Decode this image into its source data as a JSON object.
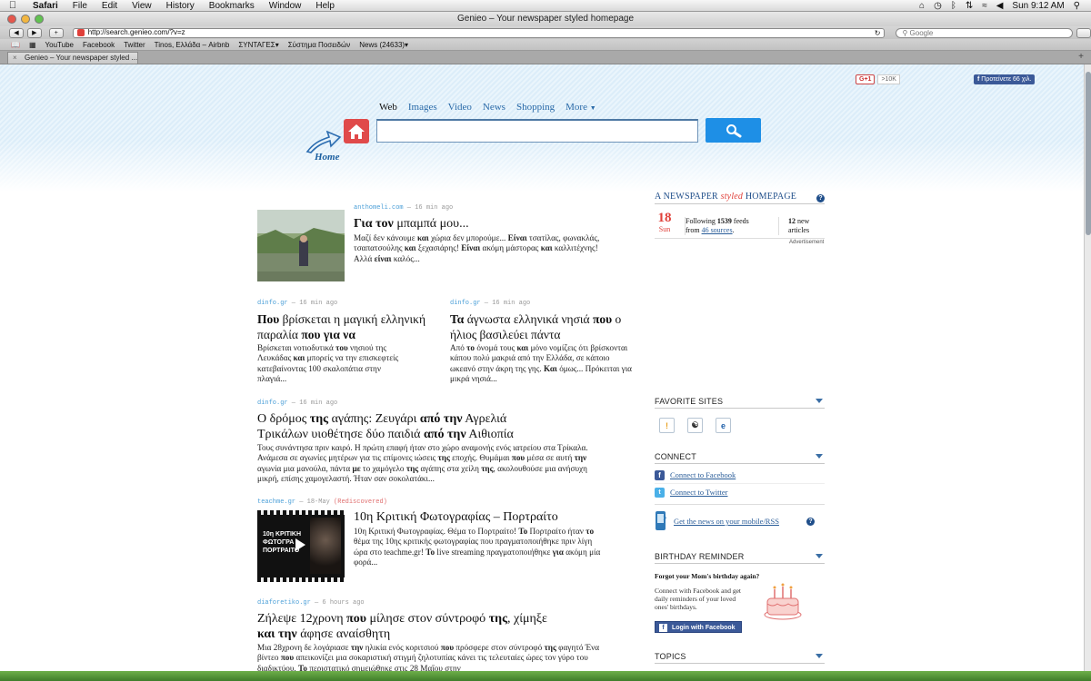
{
  "os_menu": {
    "app": "Safari",
    "items": [
      "File",
      "Edit",
      "View",
      "History",
      "Bookmarks",
      "Window",
      "Help"
    ],
    "clock": "Sun 9:12 AM"
  },
  "browser": {
    "window_title": "Genieo – Your newspaper styled homepage",
    "url": "http://search.genieo.com/?v=z",
    "search_placeholder": "Google",
    "bookmarks": [
      "YouTube",
      "Facebook",
      "Twitter",
      "Tinos, Ελλάδα – Airbnb",
      "ΣΥΝΤΑΓΕΣ▾",
      "Σύστημα Ποσειδών",
      "News (24633)▾"
    ],
    "tab_title": "Genieo – Your newspaper styled ..."
  },
  "page": {
    "social": {
      "gplus": "G+1",
      "gplus_count": ">10K",
      "fb_recommend": "Προτείνετε 66 χιλ."
    },
    "search_tabs": [
      "Web",
      "Images",
      "Video",
      "News",
      "Shopping",
      "More"
    ],
    "home_label": "Home",
    "search_value": ""
  },
  "articles": [
    {
      "source": "anthomeli.com",
      "age": "16 min ago",
      "title_parts": [
        [
          "Για",
          true
        ],
        [
          " ",
          false
        ],
        [
          "τον",
          true
        ],
        [
          " μπαμπά μου...",
          false
        ]
      ],
      "snippet_parts": [
        [
          "Μαζί δεν κάνουμε ",
          false
        ],
        [
          "και",
          true
        ],
        [
          " χώρια δεν μπορούμε... ",
          false
        ],
        [
          "Είναι",
          true
        ],
        [
          " τσατίλας, φωνακλάς, τσαπατσούλης ",
          false
        ],
        [
          "και",
          true
        ],
        [
          " ξεχασιάρης! ",
          false
        ],
        [
          "Είναι",
          true
        ],
        [
          " ακόμη μάστορας ",
          false
        ],
        [
          "και",
          true
        ],
        [
          " καλλιτέχνης! Αλλά ",
          false
        ],
        [
          "είναι",
          true
        ],
        [
          " καλός...",
          false
        ]
      ]
    },
    {
      "source": "dinfo.gr",
      "age": "16 min ago",
      "title_parts": [
        [
          "Που",
          true
        ],
        [
          " βρίσκεται η μαγική ελληνική παραλία ",
          false
        ],
        [
          "που",
          true
        ],
        [
          " ",
          false
        ],
        [
          "για",
          true
        ],
        [
          " ",
          false
        ],
        [
          "να",
          true
        ]
      ],
      "snippet_parts": [
        [
          "Βρίσκεται νοτιοδυτικά ",
          false
        ],
        [
          "του",
          true
        ],
        [
          " νησιού της Λευκάδας ",
          false
        ],
        [
          "και",
          true
        ],
        [
          " μπορείς να την επισκεφτείς κατεβαίνοντας 100 σκαλοπάτια στην πλαγιά...",
          false
        ]
      ]
    },
    {
      "source": "dinfo.gr",
      "age": "16 min ago",
      "title_parts": [
        [
          "Τα",
          true
        ],
        [
          " άγνωστα ελληνικά νησιά ",
          false
        ],
        [
          "που",
          true
        ],
        [
          " ο ήλιος βασιλεύει πάντα",
          false
        ]
      ],
      "snippet_parts": [
        [
          "Από ",
          false
        ],
        [
          "το",
          true
        ],
        [
          " όνομά τους ",
          false
        ],
        [
          "και",
          true
        ],
        [
          " μόνο νομίζεις ότι βρίσκονται κάπου πολύ μακριά από την Ελλάδα, σε κάποιο ωκεανό στην άκρη της γης. ",
          false
        ],
        [
          "Και",
          true
        ],
        [
          " όμως... Πρόκειται για μικρά νησιά...",
          false
        ]
      ]
    },
    {
      "source": "dinfo.gr",
      "age": "16 min ago",
      "title_parts": [
        [
          "Ο δρόμος ",
          false
        ],
        [
          "της",
          true
        ],
        [
          " αγάπης: Ζευγάρι ",
          false
        ],
        [
          "από την",
          true
        ],
        [
          " Αγρελιά Τρικάλων υιοθέτησε δύο παιδιά ",
          false
        ],
        [
          "από την",
          true
        ],
        [
          " Αιθιοπία",
          false
        ]
      ],
      "snippet_parts": [
        [
          "Τους συνάντησα πριν καιρό. Η πρώτη επαφή ήταν στο χώρο αναμονής ενός ιατρείου στα Τρίκαλα. Ανάμεσα σε αγωνίες μητέρων για τις επίμονες ιώσεις ",
          false
        ],
        [
          "της",
          true
        ],
        [
          " εποχής. Θυμάμαι ",
          false
        ],
        [
          "που",
          true
        ],
        [
          " μέσα σε αυτή ",
          false
        ],
        [
          "την",
          true
        ],
        [
          " αγωνία μια μανούλα, πάντα ",
          false
        ],
        [
          "με",
          true
        ],
        [
          " το χαμόγελο ",
          false
        ],
        [
          "της",
          true
        ],
        [
          " αγάπης στα χείλη ",
          false
        ],
        [
          "της",
          true
        ],
        [
          ", ακολουθούσε μια ανήσυχη μικρή, επίσης χαμογελαστή. Ήταν σαν σοκολατάκι...",
          false
        ]
      ]
    },
    {
      "source": "teachme.gr",
      "age": "18-May",
      "note": "(Rediscovered)",
      "title_parts": [
        [
          "10η Κριτική Φωτογραφίας – Πορτραίτο",
          false
        ]
      ],
      "snippet_parts": [
        [
          "10η Κριτική Φωτογραφίας. Θέμα το Πορτραίτο! ",
          false
        ],
        [
          "Το",
          true
        ],
        [
          " Πορτραίτο ήταν ",
          false
        ],
        [
          "το",
          true
        ],
        [
          " θέμα της 10ης κριτικής φωτογραφίας που πραγματοποιήθηκε πριν λίγη ώρα στο teachme.gr! ",
          false
        ],
        [
          "Το",
          true
        ],
        [
          " live streaming πραγματοποιήθηκε ",
          false
        ],
        [
          "για",
          true
        ],
        [
          " ακόμη μία φορά...",
          false
        ]
      ],
      "thumb_text": "10η ΚΡΙΤΙΚΗ ΦΩΤΟΓΡΑ ΠΟΡΤΡΑΙΤΟ"
    },
    {
      "source": "diaforetiko.gr",
      "age": "6 hours ago",
      "title_parts": [
        [
          "Ζήλεψε 12χρονη ",
          false
        ],
        [
          "που",
          true
        ],
        [
          " μίλησε στον σύντροφό ",
          false
        ],
        [
          "της",
          true
        ],
        [
          ", χίμηξε ",
          false
        ],
        [
          "και την",
          true
        ],
        [
          " άφησε αναίσθητη",
          false
        ]
      ],
      "snippet_parts": [
        [
          "Μια 28χρονη δε λογάριασε ",
          false
        ],
        [
          "την",
          true
        ],
        [
          " ηλικία ενός κοριτσιού ",
          false
        ],
        [
          "που",
          true
        ],
        [
          " πρόσφερε στον σύντροφό ",
          false
        ],
        [
          "της",
          true
        ],
        [
          " φαγητό Ένα βίντεο ",
          false
        ],
        [
          "που",
          true
        ],
        [
          " απεικονίζει μια σοκαριστική στιγμή ζηλοτυπίας κάνει τις τελευταίες ώρες τον γύρο του διαδικτύου. ",
          false
        ],
        [
          "Το",
          true
        ],
        [
          " περιστατικό σημειώθηκε στις 28 Μαΐου στην",
          false
        ]
      ]
    }
  ],
  "sidebar": {
    "brand_a": "A NEWSPAPER",
    "brand_b": "styled",
    "brand_c": "HOMEPAGE",
    "date_day": "18",
    "date_wd": "Sun",
    "feeds_pre": "Following",
    "feeds_count": "1539",
    "feeds_post": "feeds",
    "from": "from",
    "sources_link": "46 sources",
    "new_count": "12",
    "new_label": "new",
    "new_label2": "articles",
    "advertisement": "Advertisement",
    "favorite_sites": "FAVORITE SITES",
    "connect": "CONNECT",
    "connect_fb": "Connect to Facebook",
    "connect_tw": "Connect to Twitter",
    "mobile_link": "Get the news on your mobile/RSS",
    "birthday": "BIRTHDAY REMINDER",
    "bday_title": "Forgot your Mom's birthday again?",
    "bday_text": "Connect with Facebook and get daily reminders of your loved ones' birthdays.",
    "bday_btn": "Login with Facebook",
    "topics": "TOPICS"
  }
}
